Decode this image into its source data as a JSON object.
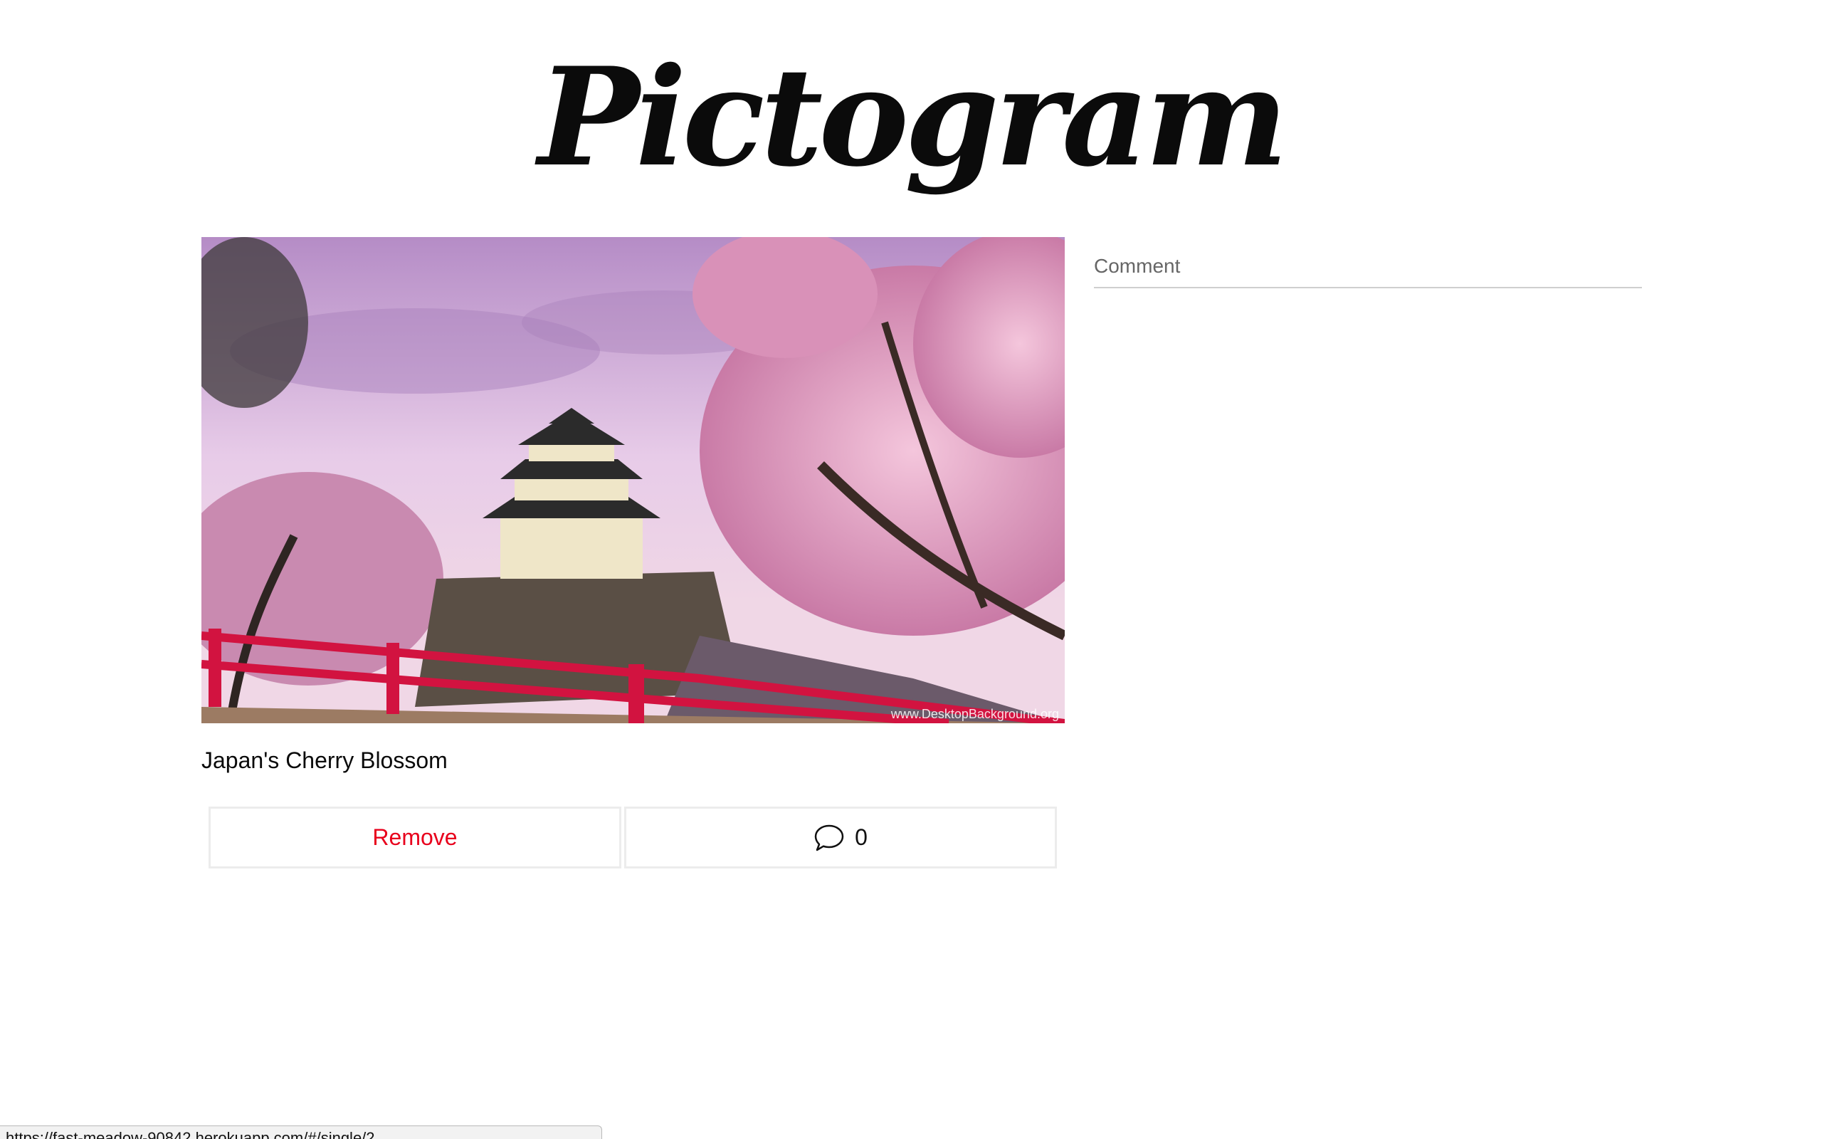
{
  "header": {
    "logo_text": "Pictogram"
  },
  "post": {
    "caption": "Japan's Cherry Blossom",
    "image_alt": "Japan's Cherry Blossom",
    "watermark": "www.DesktopBackground.org",
    "remove_label": "Remove",
    "comment_count": "0",
    "comment_icon": "speech-bubble-icon"
  },
  "comment_form": {
    "placeholder": "Comment"
  },
  "status_bar": {
    "url": "https://fast-meadow-90842.herokuapp.com/#/single/2"
  },
  "colors": {
    "remove": "#e8001c",
    "bridge": "#d21340",
    "blossom": "#e8a8c8",
    "sky": "#c9a8d8"
  }
}
